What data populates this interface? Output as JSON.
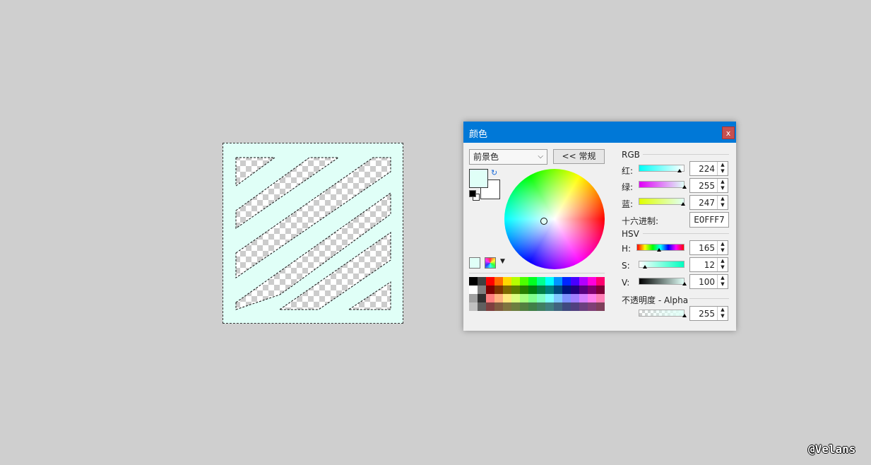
{
  "dialog": {
    "title": "颜色",
    "close_label": "x",
    "color_target": "前景色",
    "simple_button": "<< 常规"
  },
  "rgb": {
    "section": "RGB",
    "red_label": "红:",
    "red_value": "224",
    "green_label": "绿:",
    "green_value": "255",
    "blue_label": "蓝:",
    "blue_value": "247",
    "hex_label": "十六进制:",
    "hex_value": "E0FFF7"
  },
  "hsv": {
    "section": "HSV",
    "h_label": "H:",
    "h_value": "165",
    "s_label": "S:",
    "s_value": "12",
    "v_label": "V:",
    "v_value": "100"
  },
  "alpha": {
    "label": "不透明度 - Alpha",
    "value": "255"
  },
  "colors": {
    "primary": "#e0fff7",
    "accent_titlebar": "#0078d7",
    "close": "#c75050"
  },
  "palette": [
    "#000000",
    "#404040",
    "#ff0000",
    "#ff6a00",
    "#ffd800",
    "#b6ff00",
    "#4cff00",
    "#00ff21",
    "#00ff90",
    "#00ffff",
    "#0094ff",
    "#0026ff",
    "#4800ff",
    "#b200ff",
    "#ff00dc",
    "#ff006e",
    "#ffffff",
    "#808080",
    "#7f0000",
    "#7f3300",
    "#7f6a00",
    "#5b7f00",
    "#267f00",
    "#007f0e",
    "#007f46",
    "#007f7f",
    "#004a7f",
    "#00137f",
    "#21007f",
    "#57007f",
    "#7f006e",
    "#7f0037",
    "#a0a0a0",
    "#303030",
    "#ff7f7f",
    "#ffb27f",
    "#ffe97f",
    "#daff7f",
    "#a5ff7f",
    "#7fff8e",
    "#7fffc5",
    "#7fffff",
    "#7fc9ff",
    "#7f92ff",
    "#a17fff",
    "#d67fff",
    "#ff7fed",
    "#ff7fb6",
    "#c0c0c0",
    "#606060",
    "#7f3f3f",
    "#7f5b3f",
    "#7f743f",
    "#6d7f3f",
    "#527f3f",
    "#3f7f47",
    "#3f7f62",
    "#3f7f7f",
    "#3f647f",
    "#3f497f",
    "#503f7f",
    "#6b3f7f",
    "#7f3f76",
    "#7f3f5b"
  ],
  "watermark": "@Velans"
}
